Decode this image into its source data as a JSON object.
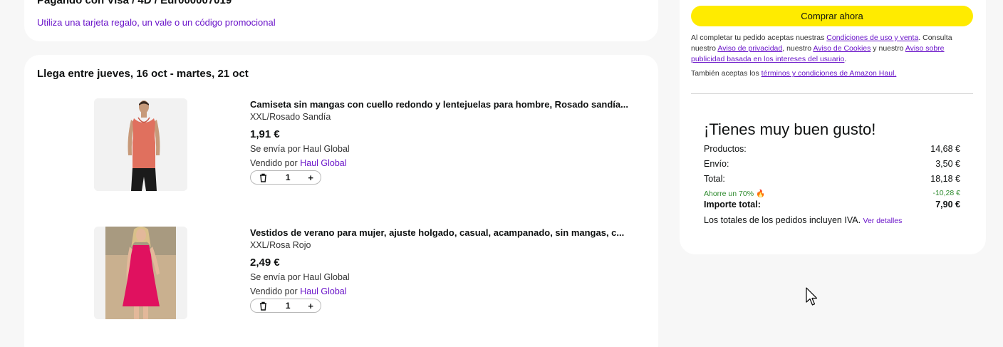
{
  "payment": {
    "title_partial": "Pagando con Visa / 4D / Eur000007019",
    "gift_link": "Utiliza una tarjeta regalo, un vale o un código promocional"
  },
  "delivery": {
    "title": "Llega entre jueves, 16 oct - martes, 21 oct",
    "items": [
      {
        "title": "Camiseta sin mangas con cuello redondo y lentejuelas para hombre, Rosado sandía...",
        "variant": "XXL/Rosado Sandía",
        "price": "1,91 €",
        "shipping": "Se envía por Haul Global",
        "seller_prefix": "Vendido por",
        "seller": "Haul Global",
        "quantity": "1",
        "plus": "+"
      },
      {
        "title": "Vestidos de verano para mujer, ajuste holgado, casual, acampanado, sin mangas, c...",
        "variant": "XXL/Rosa Rojo",
        "price": "2,49 €",
        "shipping": "Se envía por Haul Global",
        "seller_prefix": "Vendido por",
        "seller": "Haul Global",
        "quantity": "1",
        "plus": "+"
      }
    ]
  },
  "summary": {
    "buy_button": "Comprar ahora",
    "legal": {
      "t1": "Al completar tu pedido aceptas nuestras ",
      "l1": "Condiciones de uso y venta",
      "t2": ". Consulta nuestro ",
      "l2": "Aviso de privacidad",
      "t3": ", nuestro ",
      "l3": "Aviso de Cookies",
      "t4": " y nuestro ",
      "l4": "Aviso sobre publicidad basada en los intereses del usuario",
      "t5": ".",
      "t6": "También aceptas los ",
      "l5": "términos y condiciones de Amazon Haul."
    },
    "title": "¡Tienes muy buen gusto!",
    "rows": {
      "products_label": "Productos:",
      "products_value": "14,68 €",
      "shipping_label": "Envío:",
      "shipping_value": "3,50 €",
      "total_label": "Total:",
      "total_value": "18,18 €",
      "savings_label": "Ahorre un 70%",
      "savings_value": "-10,28 €",
      "grand_label": "Importe total:",
      "grand_value": "7,90 €"
    },
    "note": "Los totales de los pedidos incluyen IVA.",
    "note_link": "Ver detalles"
  },
  "colors": {
    "accent_link": "#6a14c9",
    "buy_button": "#ffeb00",
    "savings": "#2e8b2e"
  }
}
